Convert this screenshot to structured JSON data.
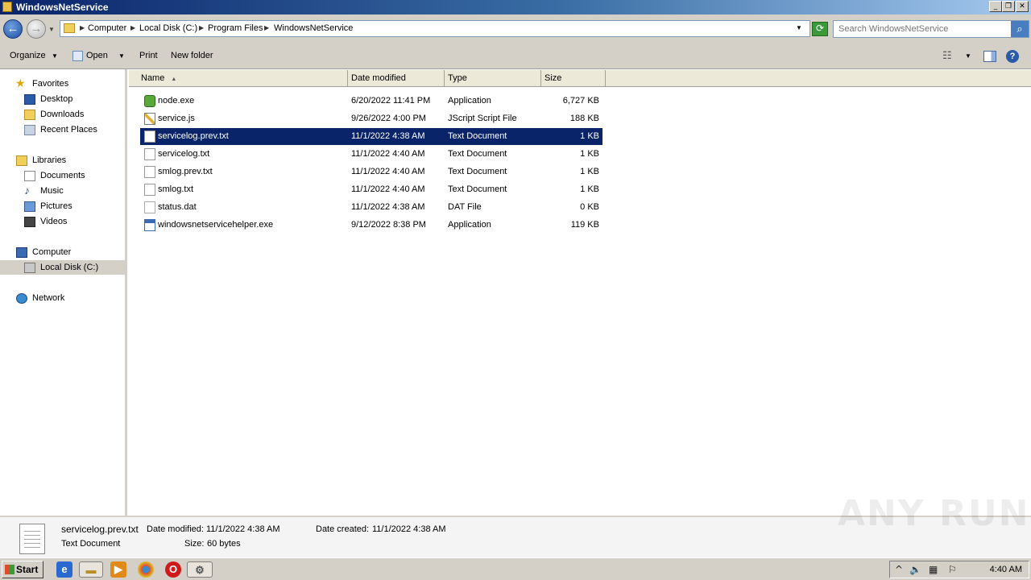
{
  "window": {
    "title": "WindowsNetService"
  },
  "address": {
    "crumbs": [
      "Computer",
      "Local Disk (C:)",
      "Program Files",
      "WindowsNetService"
    ]
  },
  "search": {
    "placeholder": "Search WindowsNetService"
  },
  "toolbar": {
    "organize": "Organize",
    "open": "Open",
    "print": "Print",
    "new_folder": "New folder"
  },
  "nav": {
    "favorites": "Favorites",
    "desktop": "Desktop",
    "downloads": "Downloads",
    "recent": "Recent Places",
    "libraries": "Libraries",
    "documents": "Documents",
    "music": "Music",
    "pictures": "Pictures",
    "videos": "Videos",
    "computer": "Computer",
    "local_disk": "Local Disk (C:)",
    "network": "Network"
  },
  "columns": {
    "name": "Name",
    "date": "Date modified",
    "type": "Type",
    "size": "Size"
  },
  "files": [
    {
      "name": "node.exe",
      "date": "6/20/2022 11:41 PM",
      "type": "Application",
      "size": "6,727 KB",
      "icon": "node-icon"
    },
    {
      "name": "service.js",
      "date": "9/26/2022 4:00 PM",
      "type": "JScript Script File",
      "size": "188 KB",
      "icon": "script-icon"
    },
    {
      "name": "servicelog.prev.txt",
      "date": "11/1/2022 4:38 AM",
      "type": "Text Document",
      "size": "1 KB",
      "icon": "text-file-icon",
      "selected": true
    },
    {
      "name": "servicelog.txt",
      "date": "11/1/2022 4:40 AM",
      "type": "Text Document",
      "size": "1 KB",
      "icon": "text-file-icon"
    },
    {
      "name": "smlog.prev.txt",
      "date": "11/1/2022 4:40 AM",
      "type": "Text Document",
      "size": "1 KB",
      "icon": "text-file-icon"
    },
    {
      "name": "smlog.txt",
      "date": "11/1/2022 4:40 AM",
      "type": "Text Document",
      "size": "1 KB",
      "icon": "text-file-icon"
    },
    {
      "name": "status.dat",
      "date": "11/1/2022 4:38 AM",
      "type": "DAT File",
      "size": "0 KB",
      "icon": "blank-file-icon"
    },
    {
      "name": "windowsnetservicehelper.exe",
      "date": "9/12/2022 8:38 PM",
      "type": "Application",
      "size": "119 KB",
      "icon": "exe-icon"
    }
  ],
  "details": {
    "filename": "servicelog.prev.txt",
    "type": "Text Document",
    "modified_label": "Date modified:",
    "modified": "11/1/2022 4:38 AM",
    "created_label": "Date created:",
    "created": "11/1/2022 4:38 AM",
    "size_label": "Size:",
    "size": "60 bytes"
  },
  "watermark": "ANY RUN",
  "taskbar": {
    "start": "Start",
    "clock": "4:40 AM"
  },
  "colors": {
    "selection": "#0a246a",
    "chrome": "#d4d0c8"
  }
}
